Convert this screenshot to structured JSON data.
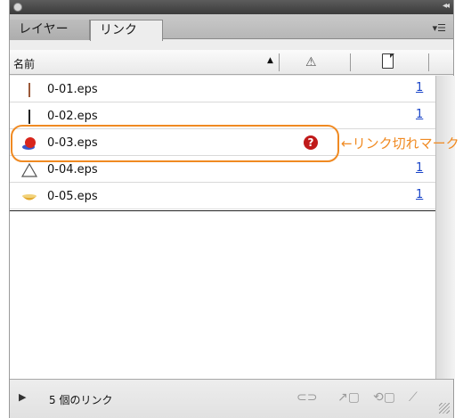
{
  "panel": {
    "tabs": [
      {
        "label": "レイヤー",
        "active": false
      },
      {
        "label": "リンク",
        "active": true
      }
    ],
    "menu_icon": "panel-menu-icon"
  },
  "columns": {
    "name": "名前",
    "sort_glyph": "▲",
    "status_icon": "warning-triangle-icon",
    "page_icon": "page-icon"
  },
  "links": [
    {
      "name": "0-01.eps",
      "page": "1",
      "thumb": "vertical-bar-brown"
    },
    {
      "name": "0-02.eps",
      "page": "1",
      "thumb": "vertical-bar-black"
    },
    {
      "name": "0-03.eps",
      "page": "",
      "thumb": "red-blue-ball",
      "status": "missing"
    },
    {
      "name": "0-04.eps",
      "page": "1",
      "thumb": "triangle-outline"
    },
    {
      "name": "0-05.eps",
      "page": "1",
      "thumb": "bowl-shape"
    }
  ],
  "annotation": {
    "callout": "←リンク切れマーク",
    "color": "#f08a22"
  },
  "footer": {
    "count_label": "5 個のリンク",
    "icons": [
      "relink-icon",
      "goto-link-icon",
      "update-link-icon",
      "edit-original-icon"
    ]
  },
  "colors": {
    "link_page": "#1a45c8",
    "error": "#c01a1a"
  }
}
